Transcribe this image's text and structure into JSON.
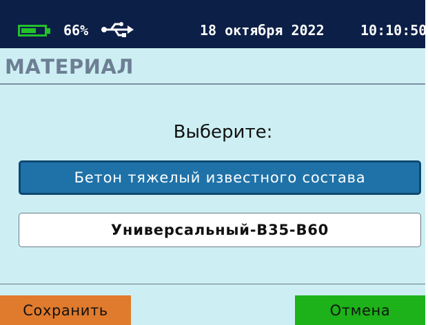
{
  "status": {
    "battery_percent_value": 0.66,
    "battery_percent": "66%",
    "usb_icon": "usb-icon",
    "date": "18 октября 2022",
    "time": "10:10:50"
  },
  "header": {
    "title": "МАТЕРИАЛ"
  },
  "main": {
    "prompt": "Выберите:",
    "options": [
      {
        "label": "Бетон тяжелый известного состава",
        "selected": true
      },
      {
        "label": "Универсальный-В35-В60",
        "selected": false
      }
    ]
  },
  "footer": {
    "save_label": "Сохранить",
    "cancel_label": "Отмена"
  },
  "colors": {
    "status_bar": "#0c1f47",
    "background": "#cdeff3",
    "battery": "#22c22a",
    "selected_option": "#1f72a8",
    "save_button": "#e07a2c",
    "cancel_button": "#1db219"
  }
}
